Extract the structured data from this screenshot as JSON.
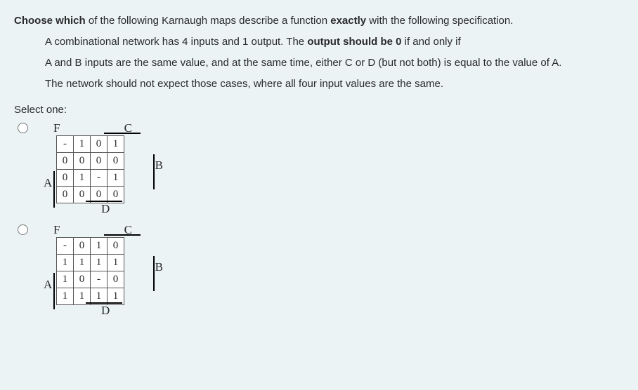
{
  "question": {
    "intro_html": "<strong>Choose which</strong> of the following Karnaugh maps describe a function <strong>exactly</strong> with the following specification.",
    "line1_html": "A combinational network has 4 inputs and 1 output. The <strong>output should be 0</strong> if and only if",
    "line2": "A and B inputs are the same value, and at the same time, either C or D (but not both) is equal to the value of A.",
    "line3": "The network should not expect those cases, where all four input values are the same."
  },
  "select_label": "Select one:",
  "labels": {
    "F": "F",
    "A": "A",
    "B": "B",
    "C": "C",
    "D": "D"
  },
  "kmaps": [
    {
      "cells": [
        [
          "-",
          "1",
          "0",
          "1"
        ],
        [
          "0",
          "0",
          "0",
          "0"
        ],
        [
          "0",
          "1",
          "-",
          "1"
        ],
        [
          "0",
          "0",
          "0",
          "0"
        ]
      ]
    },
    {
      "cells": [
        [
          "-",
          "0",
          "1",
          "0"
        ],
        [
          "1",
          "1",
          "1",
          "1"
        ],
        [
          "1",
          "0",
          "-",
          "0"
        ],
        [
          "1",
          "1",
          "1",
          "1"
        ]
      ]
    }
  ]
}
